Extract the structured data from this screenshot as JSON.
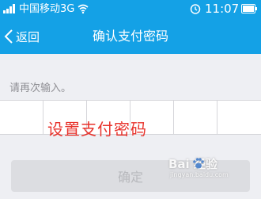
{
  "status_bar": {
    "carrier": "中国移动3G",
    "time": "11:07",
    "icons": [
      "signal-icon",
      "wifi-icon",
      "alarm-icon",
      "battery-icon"
    ]
  },
  "nav": {
    "back_label": "返回",
    "title": "确认支付密码"
  },
  "prompt": "请再次输入。",
  "pin": {
    "cells": 6
  },
  "overlay_text": "设置支付密码",
  "confirm_label": "确定",
  "watermark": {
    "text": "Bai 经验",
    "sub": "jingyan.baidu.com"
  },
  "colors": {
    "header": "#14a1e6",
    "background": "#eeeff3",
    "overlay_text": "#e8332c",
    "button_disabled": "#dcdde1"
  }
}
